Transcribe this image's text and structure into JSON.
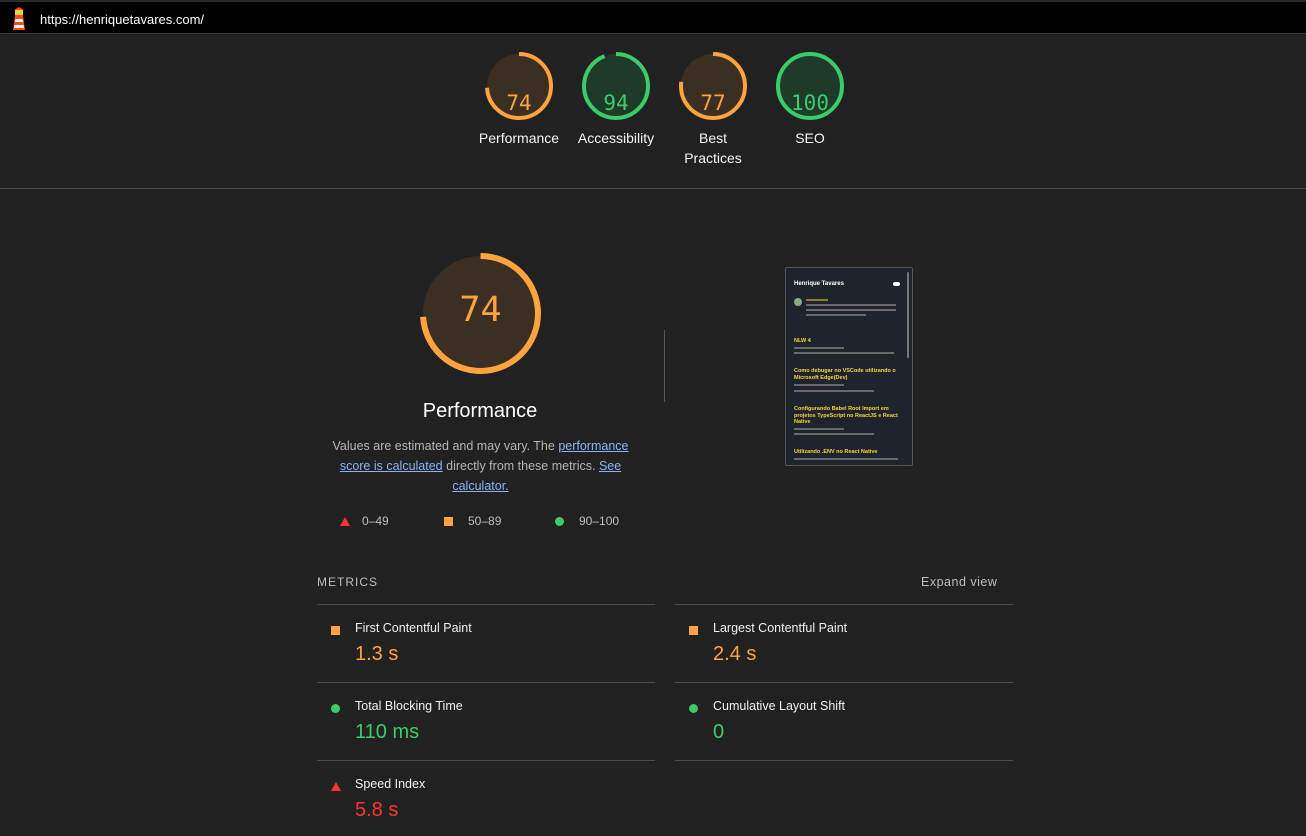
{
  "topbar": {
    "url": "https://henriquetavares.com/",
    "logo_icon": "lighthouse-icon"
  },
  "colors": {
    "average": "#ffa33f",
    "pass": "#3bcc6a",
    "fail": "#ff3333"
  },
  "gauges": [
    {
      "score": "74",
      "label": "Performance",
      "value": 0.74,
      "rating": "average"
    },
    {
      "score": "94",
      "label": "Accessibility",
      "value": 0.94,
      "rating": "pass"
    },
    {
      "score": "77",
      "label": "Best Practices",
      "value": 0.77,
      "rating": "average"
    },
    {
      "score": "100",
      "label": "SEO",
      "value": 1.0,
      "rating": "pass"
    }
  ],
  "performance": {
    "score": "74",
    "value": 0.74,
    "title": "Performance",
    "desc_prefix": "Values are estimated and may vary. The ",
    "desc_link1": "performance score is calculated",
    "desc_middle": " directly from these metrics. ",
    "desc_link2": "See calculator."
  },
  "legend": [
    {
      "icon": "triangle-icon",
      "text": "0–49"
    },
    {
      "icon": "square-icon",
      "text": "50–89"
    },
    {
      "icon": "circle-icon",
      "text": "90–100"
    }
  ],
  "thumbnail": {
    "site_title": "Henrique Tavares",
    "posts": [
      "NLW 4",
      "Como debugar no VSCode utilizando o Microsoft Edge(Dev)",
      "Configurando Babel Root Import em projetos TypeScript no ReactJS e React Native",
      "Utilizando .ENV no React Native"
    ]
  },
  "metrics": {
    "heading": "METRICS",
    "expand_label": "Expand view",
    "items": [
      {
        "label": "First Contentful Paint",
        "value": "1.3 s",
        "rating": "average"
      },
      {
        "label": "Largest Contentful Paint",
        "value": "2.4 s",
        "rating": "average"
      },
      {
        "label": "Total Blocking Time",
        "value": "110 ms",
        "rating": "pass"
      },
      {
        "label": "Cumulative Layout Shift",
        "value": "0",
        "rating": "pass"
      },
      {
        "label": "Speed Index",
        "value": "5.8 s",
        "rating": "fail"
      }
    ]
  }
}
